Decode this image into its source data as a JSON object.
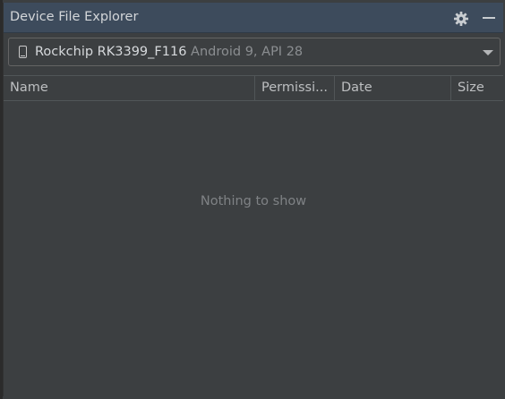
{
  "panel": {
    "title": "Device File Explorer",
    "actions": [
      {
        "icon": "gear-icon"
      },
      {
        "icon": "minimize-icon"
      }
    ]
  },
  "device_selector": {
    "icon": "phone-icon",
    "device_name": "Rockchip RK3399_F116",
    "device_details": "Android 9, API 28"
  },
  "table": {
    "columns": [
      "Name",
      "Permissi...",
      "Date",
      "Size"
    ],
    "rows": [],
    "empty_message": "Nothing to show"
  },
  "colors": {
    "background": "#3c3f41",
    "titlebar": "#3d4b5c",
    "text": "#bbbbbb",
    "muted_text": "#7f8285"
  }
}
